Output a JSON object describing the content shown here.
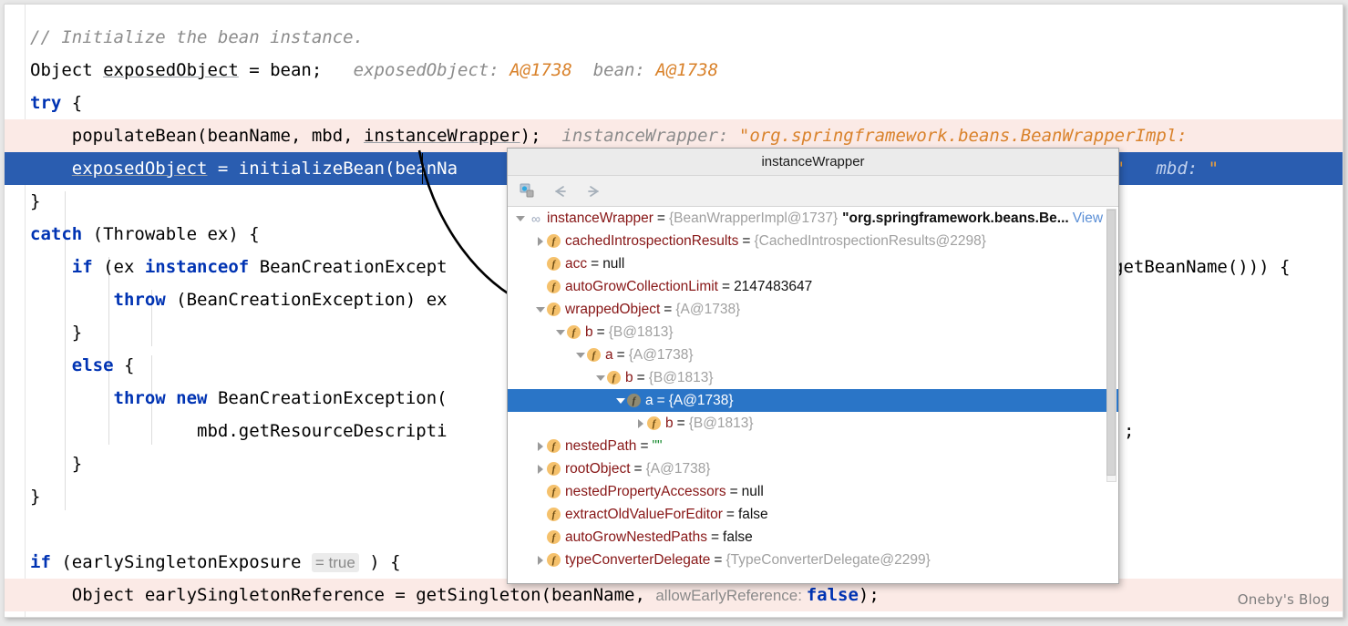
{
  "window": {
    "title": "IntelliJ IDEA debugger code view"
  },
  "editor": {
    "lines": [
      {
        "id": "l1",
        "text": "// Initialize the bean instance.",
        "kind": "comment"
      },
      {
        "id": "l2",
        "text": "Object exposedObject = bean;",
        "hints": "exposedObject: A@1738   bean: A@1738"
      },
      {
        "id": "l3",
        "text": "try {"
      },
      {
        "id": "l4",
        "text": "populateBean(beanName, mbd, instanceWrapper);",
        "hints": "instanceWrapper: \"org.springframework.beans.BeanWrapperImpl:"
      },
      {
        "id": "l5",
        "text": "exposedObject = initializeBean(beanName, exposedObject, mbd);",
        "hints": "beanName: \"a\"   mbd: \""
      },
      {
        "id": "l6",
        "text": "}"
      },
      {
        "id": "l7",
        "text": "catch (Throwable ex) {"
      },
      {
        "id": "l8",
        "text": "if (ex instanceof BeanCreationException && beanName.equals(((BeanCreationException) ex).getBeanName())) {"
      },
      {
        "id": "l9",
        "text": "throw (BeanCreationException) ex;"
      },
      {
        "id": "l10",
        "text": "}"
      },
      {
        "id": "l11",
        "text": "else {"
      },
      {
        "id": "l12",
        "text": "throw new BeanCreationException("
      },
      {
        "id": "l13",
        "text": "mbd.getResourceDescription(), beanName, \"Initialization of bean failed\", ex);"
      },
      {
        "id": "l14",
        "text": "}"
      },
      {
        "id": "l15",
        "text": "}"
      },
      {
        "id": "l16",
        "text": ""
      },
      {
        "id": "l17",
        "text": "if (earlySingletonExposure ) {",
        "inline_value": "= true"
      },
      {
        "id": "l18",
        "text": "Object earlySingletonReference = getSingleton(beanName, false);",
        "hints": "allowEarlyReference:"
      }
    ],
    "fragments": {
      "line1": "// Initialize the bean instance.",
      "line2_code": "Object exposedObject = bean;",
      "line2_hint_exposed": "exposedObject:",
      "line2_val_exposed": "A@1738",
      "line2_hint_bean": "bean:",
      "line2_val_bean": "A@1738",
      "line3": "try {",
      "line4_code": "populateBean(beanName, mbd, instanceWrapper);",
      "line4_hint": "instanceWrapper:",
      "line4_val": "\"org.springframework.beans.BeanWrapperImpl:",
      "line5_code": "exposedObject = initializeBean(beanNa",
      "line5_hint_tail": "anName:",
      "line5_val_a": "\"a\"",
      "line5_hint_mbd": "mbd:",
      "line5_val_mbd": "\"",
      "line6": "}",
      "line7": "catch (Throwable ex) {",
      "line8_a": "if (ex instanceof BeanCreationExcept",
      "line8_b": "getBeanName())) {",
      "line9": "throw (BeanCreationException) ex",
      "line10": "}",
      "line11": "else {",
      "line12": "throw new BeanCreationException(",
      "line13_a": "mbd.getResourceDescripti",
      "line13_b": ";",
      "line14": "}",
      "line15": "}",
      "line17_a": "if (earlySingletonExposure ",
      "line17_inline": "= true",
      "line17_b": ") {",
      "line18_a": "Object earlySingletonReference = getSingleton(beanName, ",
      "line18_hint": "allowEarlyReference:",
      "line18_false": "false",
      "line18_b": ");"
    }
  },
  "popup": {
    "title": "instanceWrapper",
    "toolbar": {
      "inspect_label": "inspect-icon",
      "back_label": "←",
      "forward_label": "→"
    },
    "view_link": "View",
    "rows": [
      {
        "depth": 0,
        "twisty": "down",
        "icon": "glasses",
        "name": "instanceWrapper",
        "eq": "=",
        "value": "{BeanWrapperImpl@1737}",
        "value2": "\"org.springframework.beans.Be...",
        "value_kind": "ref",
        "link": "View",
        "selected": false
      },
      {
        "depth": 1,
        "twisty": "right",
        "icon": "field",
        "name": "cachedIntrospectionResults",
        "eq": "=",
        "value": "{CachedIntrospectionResults@2298}",
        "value_kind": "ref",
        "selected": false
      },
      {
        "depth": 1,
        "twisty": "none",
        "icon": "field",
        "name": "acc",
        "eq": "=",
        "value": "null",
        "value_kind": "txt",
        "selected": false
      },
      {
        "depth": 1,
        "twisty": "none",
        "icon": "field",
        "name": "autoGrowCollectionLimit",
        "eq": "=",
        "value": "2147483647",
        "value_kind": "num",
        "selected": false
      },
      {
        "depth": 1,
        "twisty": "down",
        "icon": "field",
        "name": "wrappedObject",
        "eq": "=",
        "value": "{A@1738}",
        "value_kind": "ref",
        "selected": false
      },
      {
        "depth": 2,
        "twisty": "down",
        "icon": "field",
        "name": "b",
        "eq": "=",
        "value": "{B@1813}",
        "value_kind": "ref",
        "selected": false
      },
      {
        "depth": 3,
        "twisty": "down",
        "icon": "field",
        "name": "a",
        "eq": "=",
        "value": "{A@1738}",
        "value_kind": "ref",
        "selected": false
      },
      {
        "depth": 4,
        "twisty": "down",
        "icon": "field",
        "name": "b",
        "eq": "=",
        "value": "{B@1813}",
        "value_kind": "ref",
        "selected": false
      },
      {
        "depth": 5,
        "twisty": "down",
        "icon": "field",
        "name": "a",
        "eq": "=",
        "value": "{A@1738}",
        "value_kind": "ref",
        "selected": true
      },
      {
        "depth": 6,
        "twisty": "right",
        "icon": "field",
        "name": "b",
        "eq": "=",
        "value": "{B@1813}",
        "value_kind": "ref",
        "selected": false
      },
      {
        "depth": 1,
        "twisty": "right",
        "icon": "field",
        "name": "nestedPath",
        "eq": "=",
        "value": "\"\"",
        "value_kind": "str",
        "selected": false
      },
      {
        "depth": 1,
        "twisty": "right",
        "icon": "field",
        "name": "rootObject",
        "eq": "=",
        "value": "{A@1738}",
        "value_kind": "ref",
        "selected": false
      },
      {
        "depth": 1,
        "twisty": "none",
        "icon": "field",
        "name": "nestedPropertyAccessors",
        "eq": "=",
        "value": "null",
        "value_kind": "txt",
        "selected": false
      },
      {
        "depth": 1,
        "twisty": "none",
        "icon": "field",
        "name": "extractOldValueForEditor",
        "eq": "=",
        "value": "false",
        "value_kind": "txt",
        "selected": false
      },
      {
        "depth": 1,
        "twisty": "none",
        "icon": "field",
        "name": "autoGrowNestedPaths",
        "eq": "=",
        "value": "false",
        "value_kind": "txt",
        "selected": false
      },
      {
        "depth": 1,
        "twisty": "right",
        "icon": "field",
        "name": "typeConverterDelegate",
        "eq": "=",
        "value": "{TypeConverterDelegate@2299}",
        "value_kind": "ref",
        "selected": false
      }
    ]
  },
  "watermark": "Oneby's Blog",
  "colors": {
    "selection_blue": "#2a5db0",
    "tree_selection_blue": "#2a75c7",
    "exec_line_pink": "#fbeae6",
    "keyword_blue": "#0033b3",
    "hint_gray": "#8c8c8c",
    "hint_value_orange": "#d9822b",
    "field_name_red": "#871616",
    "ref_gray": "#a0a0a0",
    "string_green": "#178a2e"
  }
}
